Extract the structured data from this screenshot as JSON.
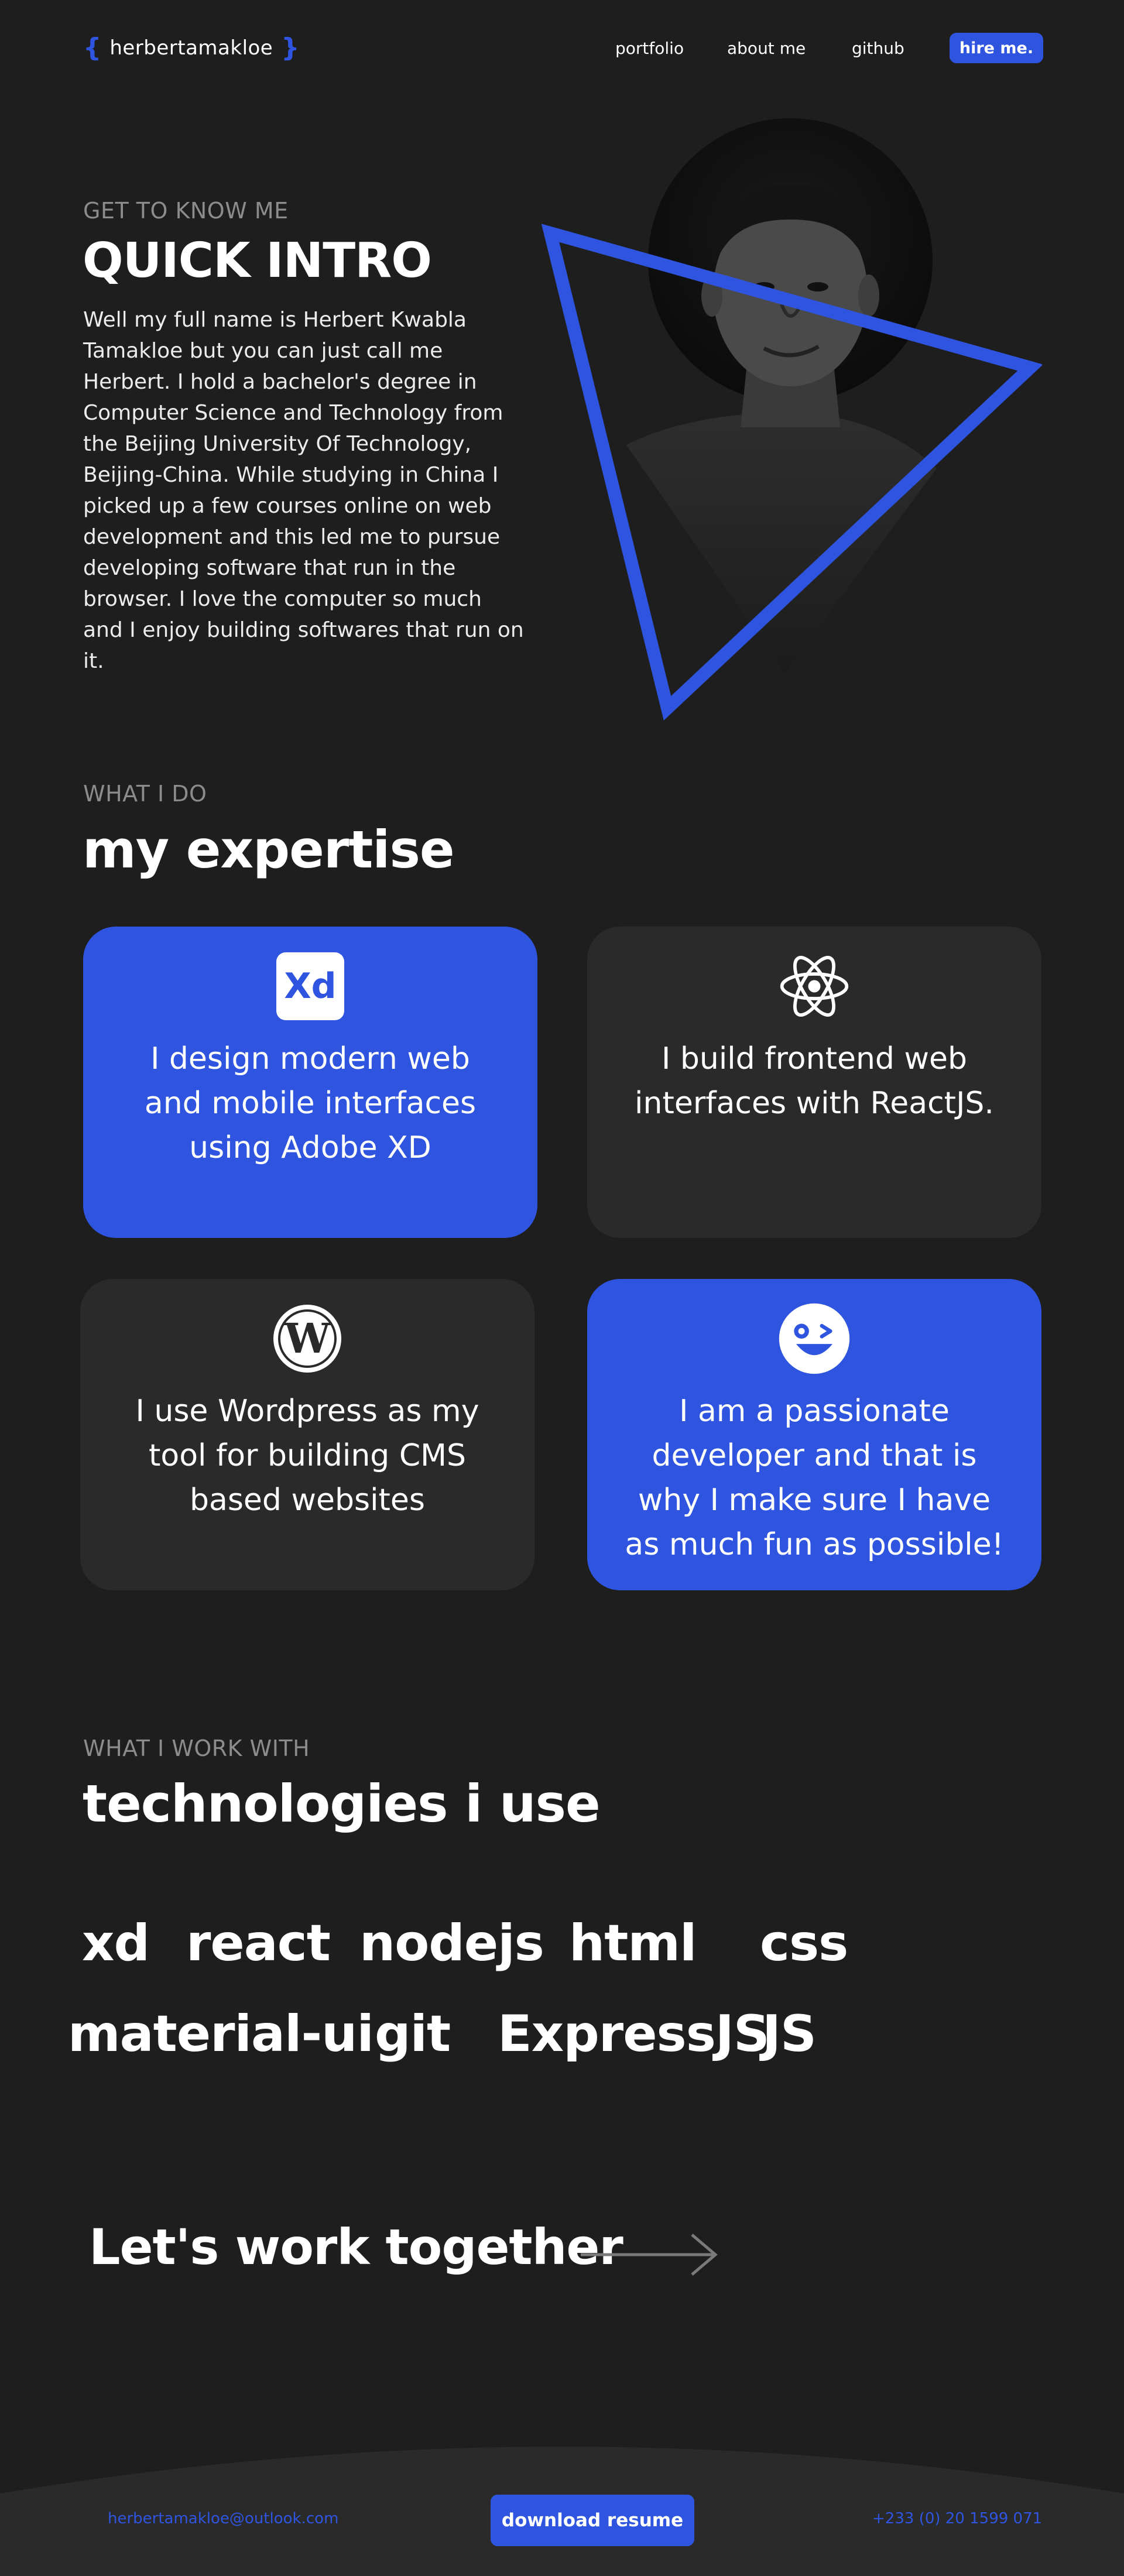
{
  "header": {
    "logo_open": "{",
    "logo_name": "herbertamakloe",
    "logo_close": "}",
    "nav": [
      "portfolio",
      "about me",
      "github"
    ],
    "hire_label": "hire me."
  },
  "intro": {
    "eyebrow": "GET TO KNOW ME",
    "title": "QUICK INTRO",
    "body": "Well my full name is Herbert Kwabla Tamakloe but you can just call me Herbert. I hold a bachelor's degree in Computer Science and Technology from the Beijing University Of Technology, Beijing-China. While studying in China I picked up a few courses online on web development and this led me to pursue developing software that run in the browser. I love the computer so much and I enjoy building softwares that run on it."
  },
  "expertise": {
    "eyebrow": "WHAT I DO",
    "title": "my expertise",
    "cards": [
      {
        "icon": "adobe-xd-icon",
        "icon_text": "Xd",
        "text": "I design modern web and mobile interfaces using Adobe XD",
        "style": "blue"
      },
      {
        "icon": "react-icon",
        "text": "I build frontend web interfaces with ReactJS.",
        "style": "dark"
      },
      {
        "icon": "wordpress-icon",
        "icon_text": "W",
        "text": "I use Wordpress as my tool for building CMS based websites",
        "style": "dark"
      },
      {
        "icon": "wink-face-icon",
        "text": "I am a passionate developer and that is why I make sure I have as much fun as possible!",
        "style": "blue"
      }
    ]
  },
  "technologies": {
    "eyebrow": "WHAT I WORK WITH",
    "title": "technologies i use",
    "items": [
      "xd",
      "react",
      "nodejs",
      "html",
      "css",
      "material-ui",
      "git",
      "ExpressJS",
      "JS"
    ]
  },
  "cta": {
    "label": "Let's work together"
  },
  "footer": {
    "email": "herbertamakloe@outlook.com",
    "resume_label": "download resume",
    "phone": "+233 (0) 20 1599 071"
  },
  "colors": {
    "background": "#1e1e1f",
    "accent": "#2f55e0",
    "card_dark": "#2a2a2b",
    "muted": "#8c8c8c"
  }
}
